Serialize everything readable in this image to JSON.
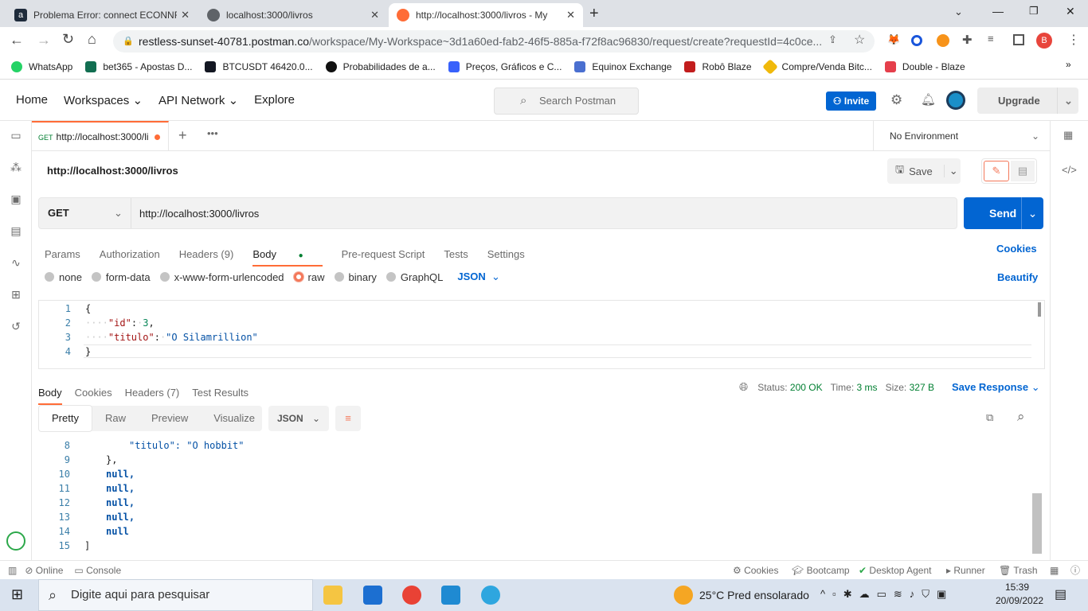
{
  "browser": {
    "tabs": [
      {
        "title": "Problema Error: connect ECONNR",
        "icon": "a-favicon",
        "active": false
      },
      {
        "title": "localhost:3000/livros",
        "icon": "globe-icon",
        "active": false
      },
      {
        "title": "http://localhost:3000/livros - My",
        "icon": "postman-icon",
        "active": true
      }
    ],
    "url_host": "restless-sunset-40781.postman.co",
    "url_path": "/workspace/My-Workspace~3d1a60ed-fab2-46f5-885a-f72f8ac96830/request/create?requestId=4c0ce...",
    "profile_initial": "B",
    "bookmarks": [
      {
        "label": "WhatsApp",
        "color": "#25d366"
      },
      {
        "label": "bet365 - Apostas D...",
        "color": "#126e51"
      },
      {
        "label": "BTCUSDT 46420.0...",
        "color": "#131722"
      },
      {
        "label": "Probabilidades de a...",
        "color": "#111111"
      },
      {
        "label": "Preços, Gráficos e C...",
        "color": "#3861fb"
      },
      {
        "label": "Equinox Exchange",
        "color": "#4a6fd0"
      },
      {
        "label": "Robô Blaze",
        "color": "#c21d1d"
      },
      {
        "label": "Compre/Venda Bitc...",
        "color": "#f0b90b"
      },
      {
        "label": "Double - Blaze",
        "color": "#e53f4b"
      }
    ]
  },
  "postman": {
    "nav": [
      "Home",
      "Workspaces",
      "API Network",
      "Explore"
    ],
    "search_placeholder": "Search Postman",
    "invite": "Invite",
    "upgrade": "Upgrade",
    "request_tab": {
      "method": "GET",
      "label": "http://localhost:3000/li"
    },
    "environment": "No Environment",
    "request_title": "http://localhost:3000/livros",
    "save": "Save",
    "method": "GET",
    "url": "http://localhost:3000/livros",
    "send": "Send",
    "param_tabs": [
      "Params",
      "Authorization",
      "Headers (9)",
      "Body",
      "Pre-request Script",
      "Tests",
      "Settings"
    ],
    "cookies": "Cookies",
    "body_types": [
      "none",
      "form-data",
      "x-www-form-urlencoded",
      "raw",
      "binary",
      "GraphQL"
    ],
    "body_format": "JSON",
    "beautify": "Beautify",
    "request_body": {
      "line_numbers": [
        "1",
        "2",
        "3",
        "4"
      ],
      "id_key": "\"id\"",
      "id_value": "3",
      "titulo_key": "\"titulo\"",
      "titulo_value": "\"O Silamrillion\""
    },
    "response_tabs": [
      "Body",
      "Cookies",
      "Headers (7)",
      "Test Results"
    ],
    "status_label": "Status:",
    "status": "200 OK",
    "time_label": "Time:",
    "time": "3 ms",
    "size_label": "Size:",
    "size": "327 B",
    "save_response": "Save Response",
    "view_tabs": [
      "Pretty",
      "Raw",
      "Preview",
      "Visualize"
    ],
    "response_format": "JSON",
    "response_lines": [
      {
        "n": "8",
        "text": "\"titulo\": \"O hobbit\""
      },
      {
        "n": "9",
        "text": "},"
      },
      {
        "n": "10",
        "text": "null,"
      },
      {
        "n": "11",
        "text": "null,"
      },
      {
        "n": "12",
        "text": "null,"
      },
      {
        "n": "13",
        "text": "null,"
      },
      {
        "n": "14",
        "text": "null"
      },
      {
        "n": "15",
        "text": "]"
      }
    ],
    "footer_left": [
      "Online",
      "Console"
    ],
    "footer_right": [
      "Cookies",
      "Bootcamp",
      "Desktop Agent",
      "Runner",
      "Trash"
    ]
  },
  "taskbar": {
    "search_placeholder": "Digite aqui para pesquisar",
    "weather": "25°C  Pred ensolarado",
    "time": "15:39",
    "date": "20/09/2022"
  },
  "colors": {
    "accent": "#ff6c37",
    "primary": "#0265d2",
    "success": "#007f31"
  }
}
